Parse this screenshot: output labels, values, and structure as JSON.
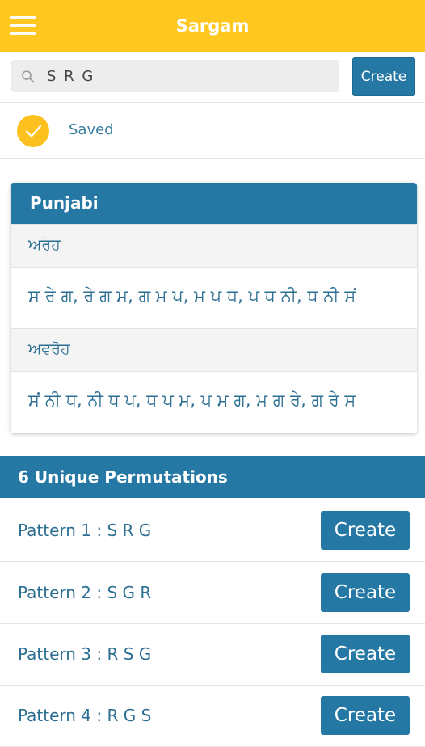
{
  "appbar": {
    "title": "Sargam",
    "menu_icon": "hamburger-menu-icon"
  },
  "search": {
    "value": "S R G",
    "placeholder": "",
    "icon": "search-icon",
    "create_label": "Create"
  },
  "status": {
    "icon": "check-circle-icon",
    "text": "Saved"
  },
  "colors": {
    "appbar": "#ffc820",
    "accent": "#2478a3",
    "text": "#2d6f92",
    "saved": "#fdc11f"
  },
  "card": {
    "title": "Punjabi",
    "aroh_label": "ਅਰੋਹ",
    "aroh": "ਸ ਰੇ ਗ, ਰੇ ਗ ਮ, ਗ ਮ ਪ, ਮ ਪ ਧ, ਪ ਧ ਨੀ, ਧ ਨੀ ਸਂ",
    "avroh_label": "ਅਵਰੋਹ",
    "avroh": "ਸਂ ਨੀ ਧ, ਨੀ ਧ ਪ, ਧ ਪ ਮ, ਪ ਮ ਗ, ਮ ਗ ਰੇ, ਗ ਰੇ ਸ"
  },
  "permutations": {
    "title": "6 Unique Permutations",
    "items": [
      {
        "label": "Pattern 1 : S R G",
        "button": "Create"
      },
      {
        "label": "Pattern 2 : S G R",
        "button": "Create"
      },
      {
        "label": "Pattern 3 : R S G",
        "button": "Create"
      },
      {
        "label": "Pattern 4 : R G S",
        "button": "Create"
      }
    ]
  }
}
